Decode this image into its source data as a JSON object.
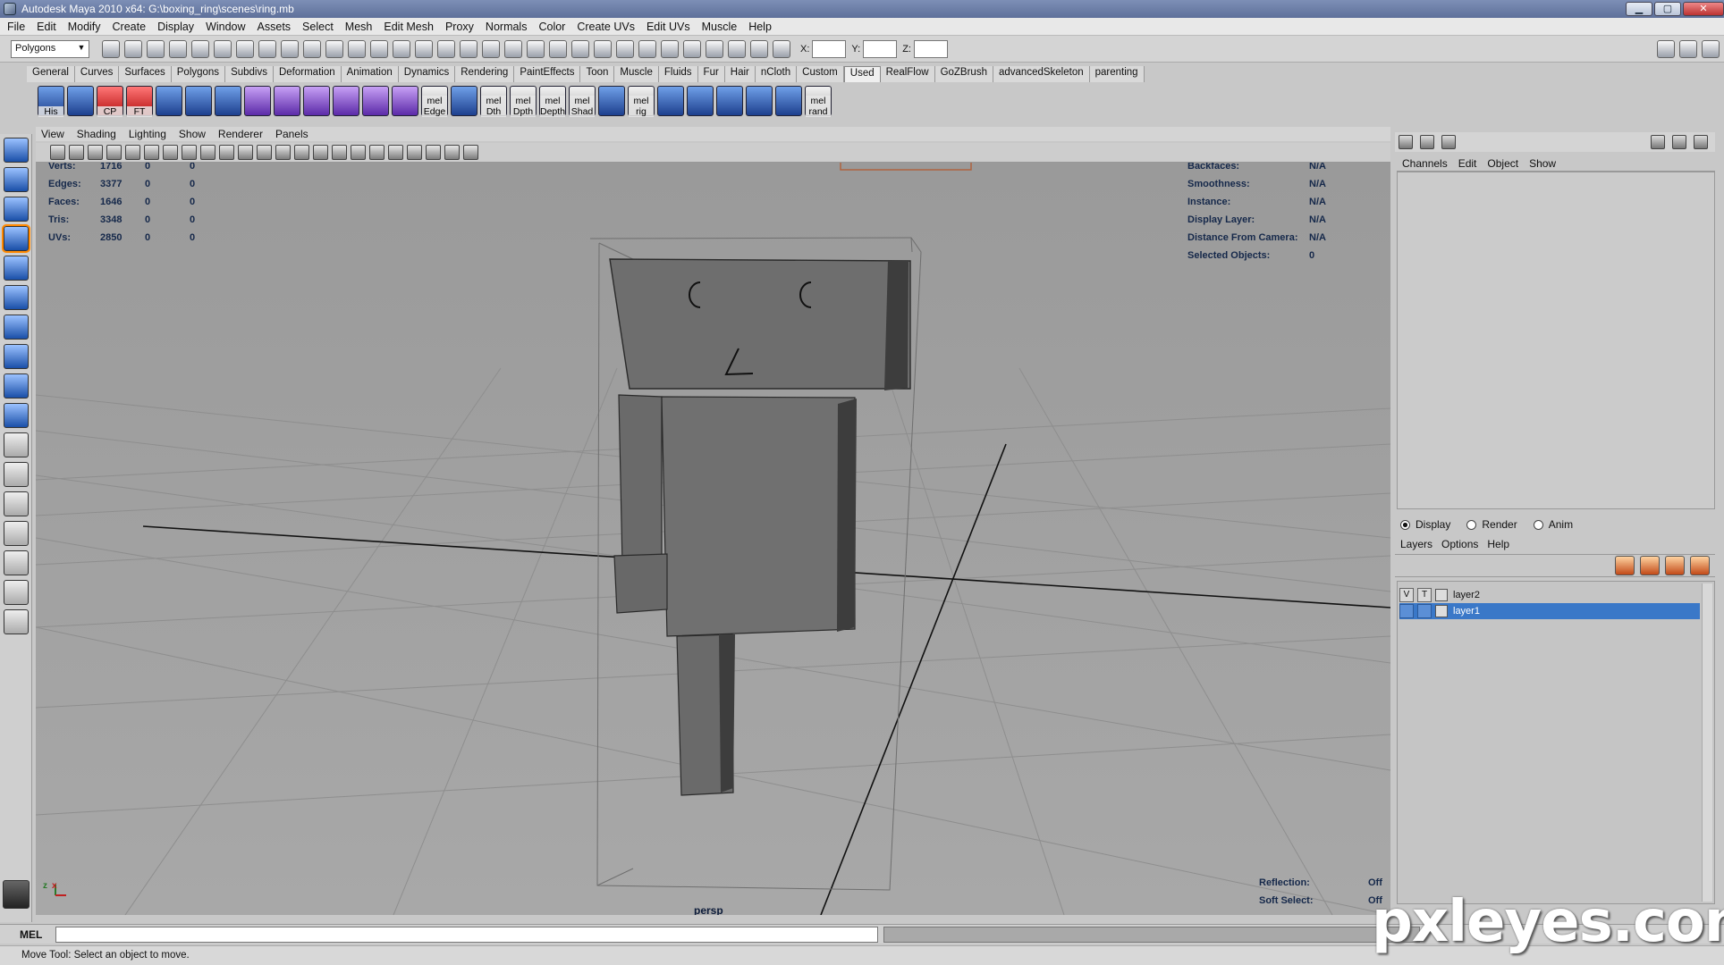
{
  "window": {
    "title": "Autodesk Maya 2010 x64: G:\\boxing_ring\\scenes\\ring.mb",
    "min_symbol": "▁",
    "max_symbol": "▢",
    "close_symbol": "✕"
  },
  "menubar": [
    "File",
    "Edit",
    "Modify",
    "Create",
    "Display",
    "Window",
    "Assets",
    "Select",
    "Mesh",
    "Edit Mesh",
    "Proxy",
    "Normals",
    "Color",
    "Create UVs",
    "Edit UVs",
    "Muscle",
    "Help"
  ],
  "statusline": {
    "menuset": "Polygons",
    "x_label": "X:",
    "y_label": "Y:",
    "z_label": "Z:"
  },
  "shelf": {
    "tabs": [
      "General",
      "Curves",
      "Surfaces",
      "Polygons",
      "Subdivs",
      "Deformation",
      "Animation",
      "Dynamics",
      "Rendering",
      "PaintEffects",
      "Toon",
      "Muscle",
      "Fluids",
      "Fur",
      "Hair",
      "nCloth",
      "Custom",
      "Used",
      "RealFlow",
      "GoZBrush",
      "advancedSkeleton",
      "parenting"
    ],
    "active_tab": "Used",
    "icon_labels": [
      "His",
      "",
      "CP",
      "FT",
      "",
      "",
      "",
      "",
      "",
      "",
      "",
      "",
      "",
      "mel Edge",
      "",
      "mel Dth",
      "mel Dpth",
      "mel Depth",
      "mel Shad",
      "",
      "mel rig",
      "",
      "",
      "",
      "",
      "",
      "mel rand"
    ]
  },
  "viewport": {
    "menu": [
      "View",
      "Shading",
      "Lighting",
      "Show",
      "Renderer",
      "Panels"
    ],
    "camera_name": "persp",
    "hud_left": [
      {
        "label": "Verts:",
        "v1": "1716",
        "v2": "0",
        "v3": "0"
      },
      {
        "label": "Edges:",
        "v1": "3377",
        "v2": "0",
        "v3": "0"
      },
      {
        "label": "Faces:",
        "v1": "1646",
        "v2": "0",
        "v3": "0"
      },
      {
        "label": "Tris:",
        "v1": "3348",
        "v2": "0",
        "v3": "0"
      },
      {
        "label": "UVs:",
        "v1": "2850",
        "v2": "0",
        "v3": "0"
      }
    ],
    "hud_right": [
      {
        "label": "Backfaces:",
        "value": "N/A"
      },
      {
        "label": "Smoothness:",
        "value": "N/A"
      },
      {
        "label": "Instance:",
        "value": "N/A"
      },
      {
        "label": "Display Layer:",
        "value": "N/A"
      },
      {
        "label": "Distance From Camera:",
        "value": "N/A"
      },
      {
        "label": "Selected Objects:",
        "value": "0"
      }
    ],
    "hud_bottom": [
      {
        "label": "Reflection:",
        "value": "Off"
      },
      {
        "label": "Soft Select:",
        "value": "Off"
      }
    ],
    "axis_x": "x",
    "axis_z": "z"
  },
  "channelbox": {
    "menu": [
      "Channels",
      "Edit",
      "Object",
      "Show"
    ]
  },
  "layers": {
    "modes": [
      {
        "label": "Display",
        "checked": true
      },
      {
        "label": "Render",
        "checked": false
      },
      {
        "label": "Anim",
        "checked": false
      }
    ],
    "menu": [
      "Layers",
      "Options",
      "Help"
    ],
    "rows": [
      {
        "v": "V",
        "t": "T",
        "name": "layer2",
        "selected": false
      },
      {
        "v": "",
        "t": "",
        "name": "layer1",
        "selected": true
      }
    ]
  },
  "cmdline": {
    "mel_label": "MEL"
  },
  "helpline": {
    "text": "Move Tool: Select an object to move."
  },
  "watermark": "pxleyes.com"
}
